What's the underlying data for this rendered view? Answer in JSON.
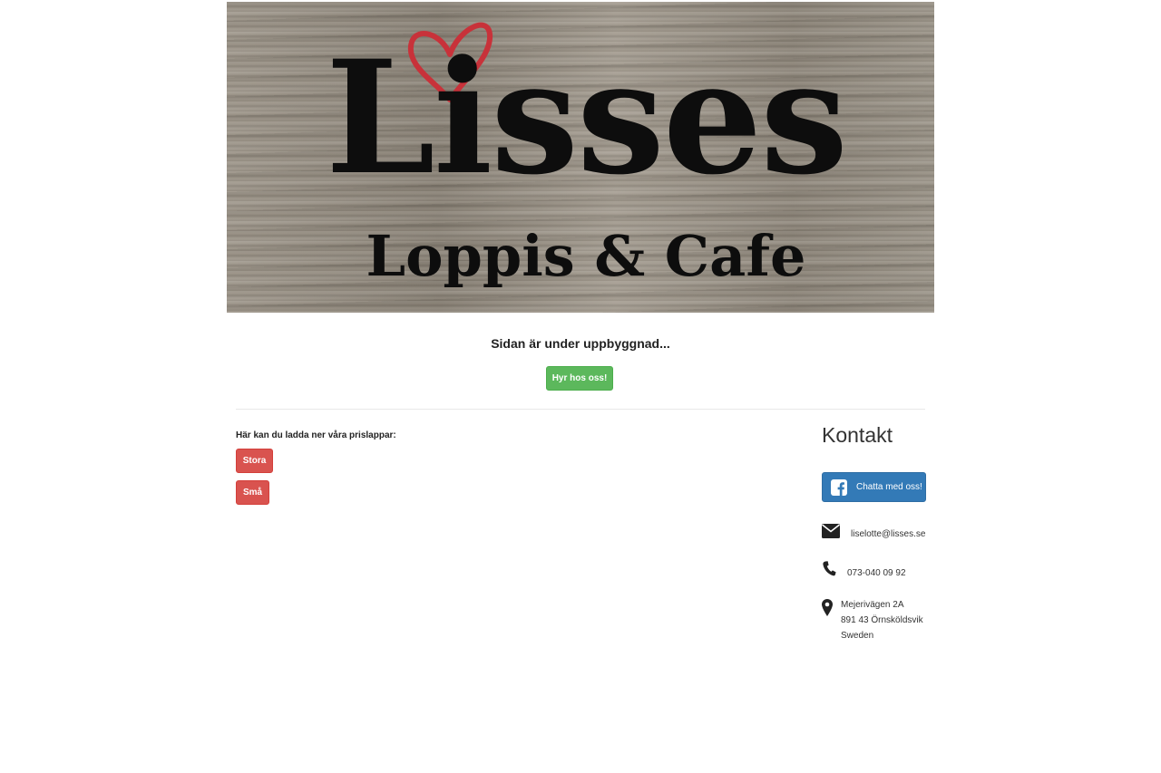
{
  "banner": {
    "logo_title": "Lisses",
    "logo_subtitle": "Loppis & Cafe"
  },
  "notice": "Sidan är under uppbyggnad...",
  "rent_button": "Hyr hos oss!",
  "downloads": {
    "label": "Här kan du ladda ner våra prislappar:",
    "buttons": [
      "Stora",
      "Små"
    ]
  },
  "contact": {
    "title": "Kontakt",
    "chat_button": "Chatta med oss!",
    "email": "liselotte@lisses.se",
    "phone": "073-040 09 92",
    "address": [
      "Mejerivägen 2A",
      "891 43 Örnsköldsvik",
      "Sweden"
    ]
  },
  "colors": {
    "green": "#5cb85c",
    "red": "#d9534f",
    "blue": "#337ab7",
    "heart": "#c8323a"
  },
  "icons": [
    "heart-icon",
    "facebook-icon",
    "envelope-icon",
    "phone-icon",
    "map-marker-icon"
  ]
}
